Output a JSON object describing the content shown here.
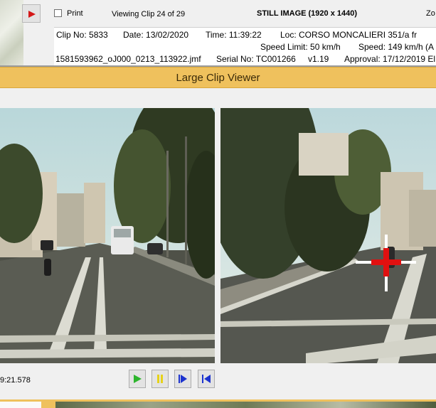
{
  "toolbar": {
    "print_label": "Print",
    "viewing_label": "Viewing Clip 24 of 29",
    "still_label": "STILL IMAGE (1920 x 1440)",
    "zoom_label": "Zo"
  },
  "info": {
    "clip_no": "Clip No: 5833",
    "date": "Date: 13/02/2020",
    "time": "Time: 11:39:22",
    "loc": "Loc: CORSO MONCALIERI 351/a fr",
    "speed_limit": "Speed Limit: 50 km/h",
    "speed": "Speed: 149 km/h (A",
    "filename": "1581593962_oJ000_0213_113922.jmf",
    "serial": "Serial No: TC001266",
    "version": "v1.19",
    "approval": "Approval: 17/12/2019 El"
  },
  "viewer": {
    "title": "Large Clip Viewer"
  },
  "playback": {
    "timestamp": "9:21.578"
  },
  "colors": {
    "title_bar": "#efc15d",
    "crosshair": "#e01010",
    "play_green": "#2db52d",
    "pause_yellow": "#e6d21a",
    "nav_blue": "#1c33cf"
  },
  "icons": [
    "play-icon",
    "pause-icon",
    "step-forward-icon",
    "skip-to-start-icon"
  ]
}
